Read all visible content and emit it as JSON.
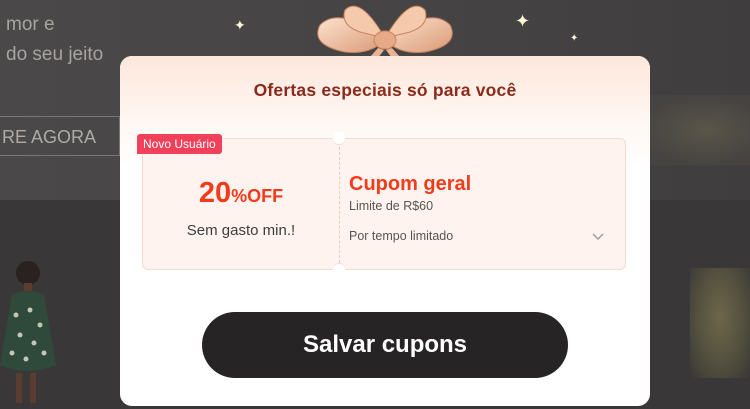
{
  "background": {
    "hero_lines": [
      "mor e",
      "do seu jeito"
    ],
    "shop_button": "RE AGORA"
  },
  "modal": {
    "title": "Ofertas especiais só para você",
    "coupon": {
      "badge": "Novo Usuário",
      "discount_value": "20",
      "discount_suffix": "%OFF",
      "min_spend": "Sem gasto min.!",
      "name": "Cupom geral",
      "limit": "Limite de R$60",
      "validity": "Por tempo limitado",
      "expand_icon": "chevron-down-icon"
    },
    "save_button": "Salvar cupons"
  },
  "colors": {
    "accent_red": "#f23b1a",
    "title_brown": "#8b2a1a",
    "badge_pink": "#f0405a",
    "button_dark": "#262424"
  }
}
